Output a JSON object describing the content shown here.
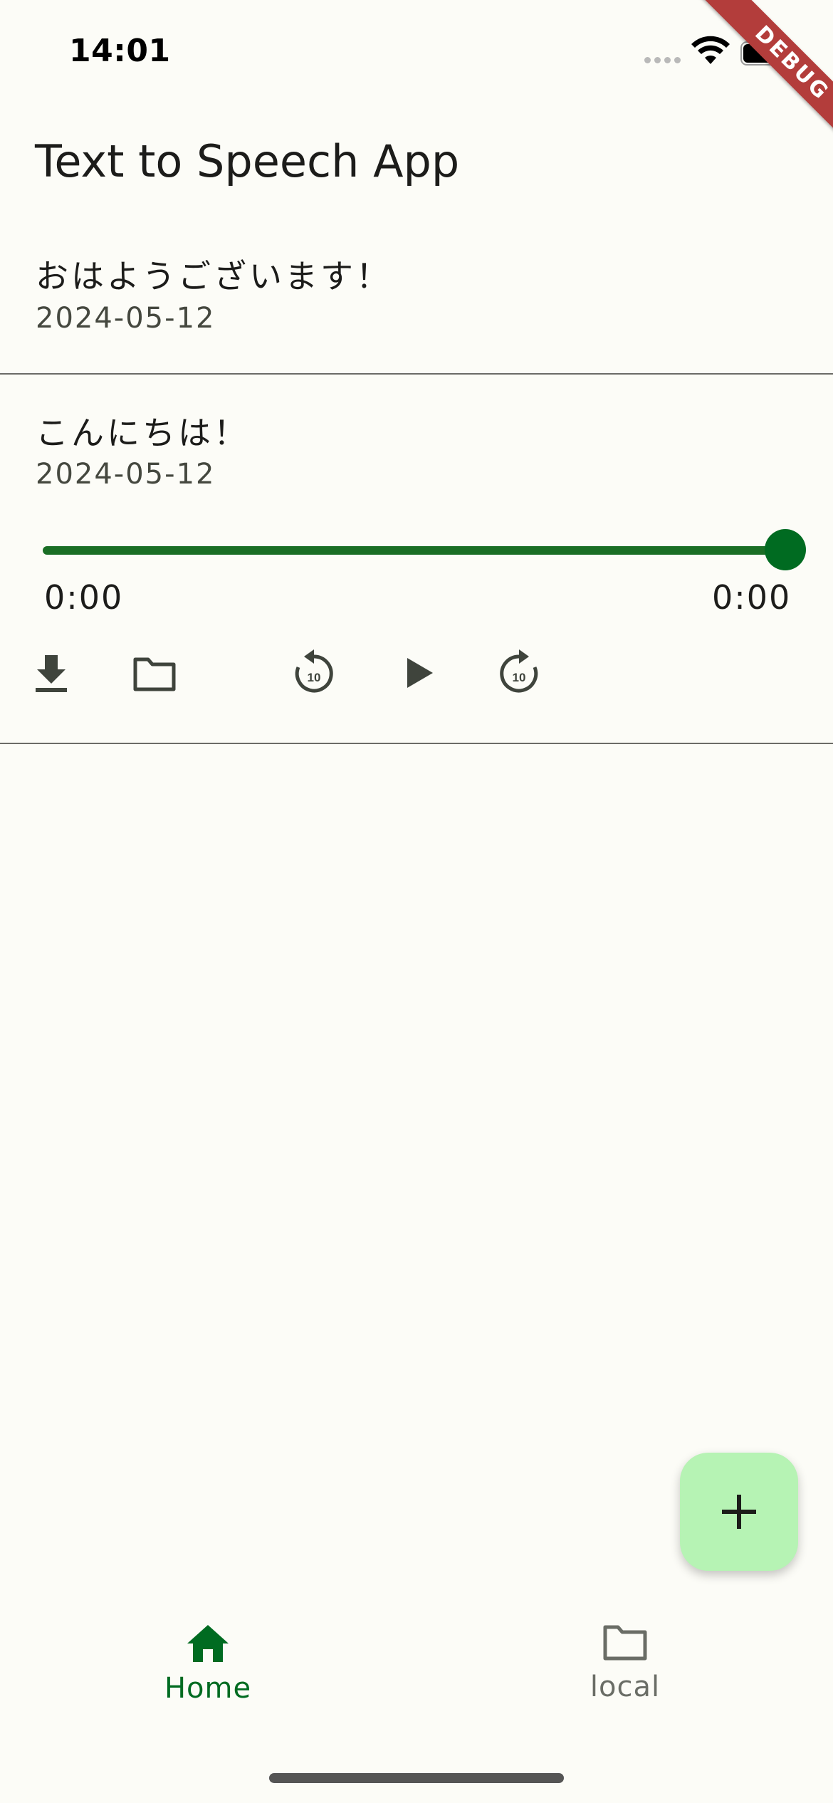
{
  "status_bar": {
    "time": "14:01"
  },
  "debug_banner": "DEBUG",
  "app_title": "Text to Speech App",
  "items": [
    {
      "text": "おはようございます！",
      "date": "2024-05-12"
    },
    {
      "text": "こんにちは！",
      "date": "2024-05-12"
    }
  ],
  "player": {
    "position": "0:00",
    "duration": "0:00",
    "progress": 1.0,
    "replay_seconds": "10",
    "forward_seconds": "10"
  },
  "bottom_nav": [
    {
      "label": "Home",
      "icon": "home-icon",
      "selected": true
    },
    {
      "label": "local",
      "icon": "folder-icon",
      "selected": false
    }
  ],
  "fab": {
    "icon": "plus-icon"
  },
  "colors": {
    "background": "#fcfcf7",
    "accent": "#006b21",
    "fab": "#b6f3b4",
    "debug": "#b33d3b"
  }
}
